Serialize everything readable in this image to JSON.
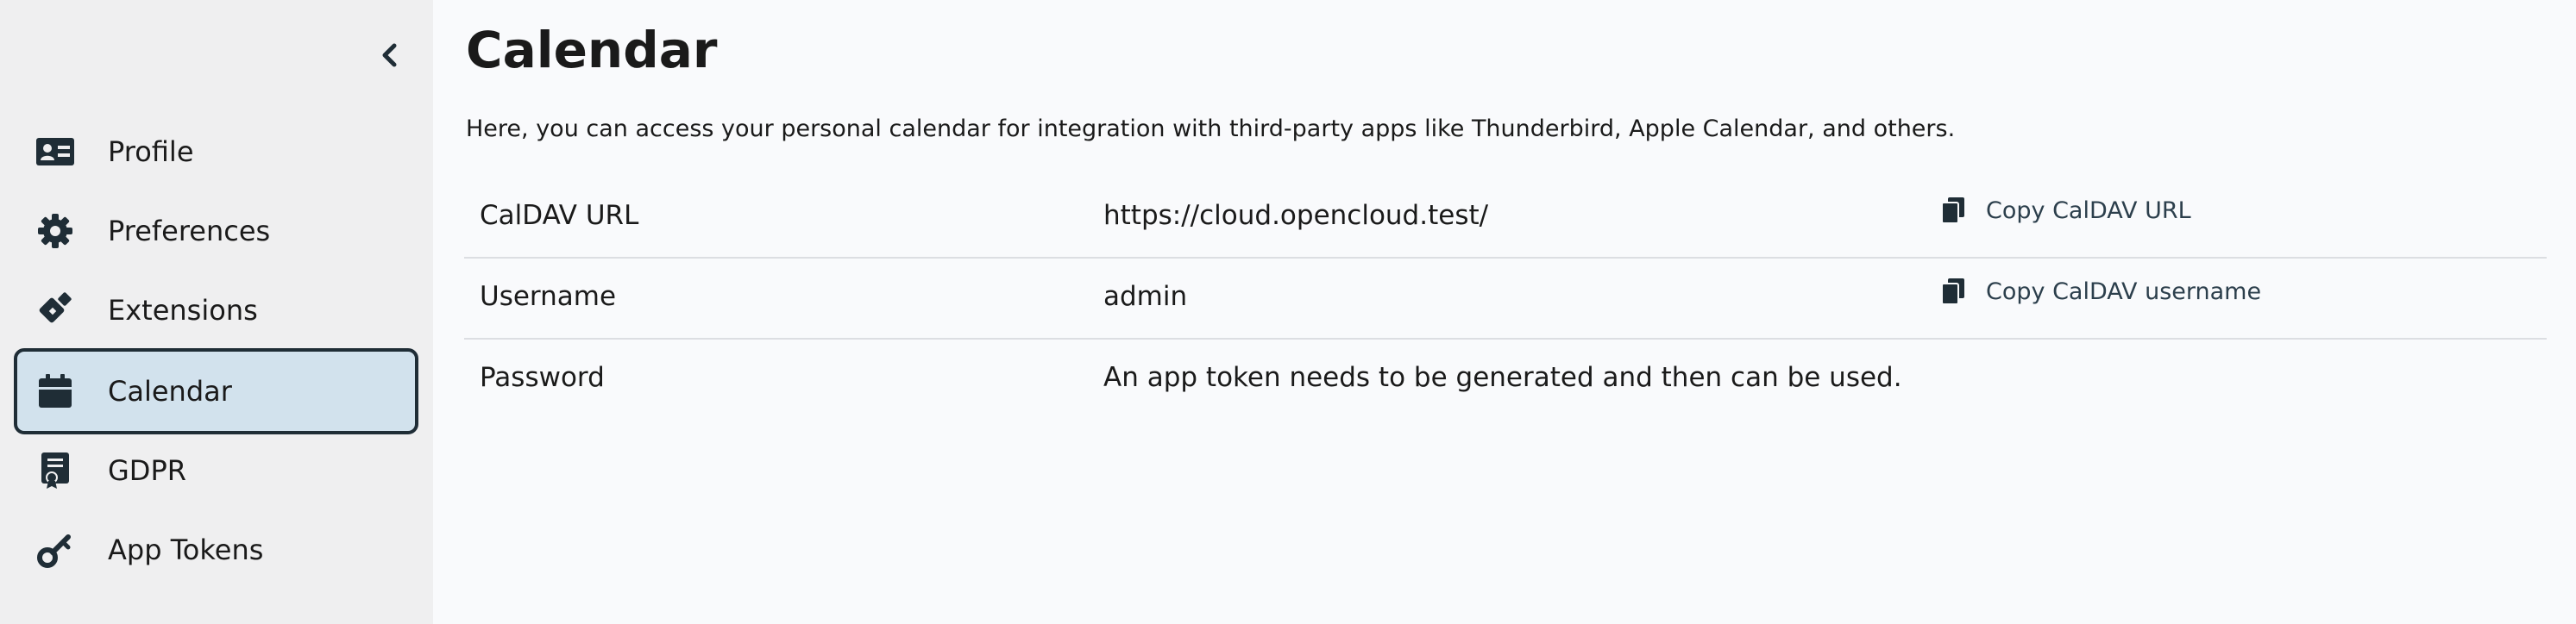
{
  "sidebar": {
    "collapse_icon": "chevron-left-icon",
    "items": [
      {
        "label": "Profile",
        "icon": "id-card-icon",
        "active": false
      },
      {
        "label": "Preferences",
        "icon": "gear-icon",
        "active": false
      },
      {
        "label": "Extensions",
        "icon": "puzzle-brush-icon",
        "active": false
      },
      {
        "label": "Calendar",
        "icon": "calendar-icon",
        "active": true
      },
      {
        "label": "GDPR",
        "icon": "document-seal-icon",
        "active": false
      },
      {
        "label": "App Tokens",
        "icon": "key-icon",
        "active": false
      }
    ]
  },
  "main": {
    "title": "Calendar",
    "description": "Here, you can access your personal calendar for integration with third-party apps like Thunderbird, Apple Calendar, and others.",
    "rows": [
      {
        "label": "CalDAV URL",
        "value": "https://cloud.opencloud.test/",
        "action": "Copy CalDAV URL"
      },
      {
        "label": "Username",
        "value": "admin",
        "action": "Copy CalDAV username"
      },
      {
        "label": "Password",
        "value": "An app token needs to be generated and then can be used.",
        "action": ""
      }
    ]
  },
  "colors": {
    "sidebar_bg": "#efeff0",
    "main_bg": "#f9fafc",
    "active_bg": "#d2e2ed",
    "active_border": "#1f2d36",
    "icon": "#1f2d36",
    "row_divider": "#dcdee2"
  }
}
